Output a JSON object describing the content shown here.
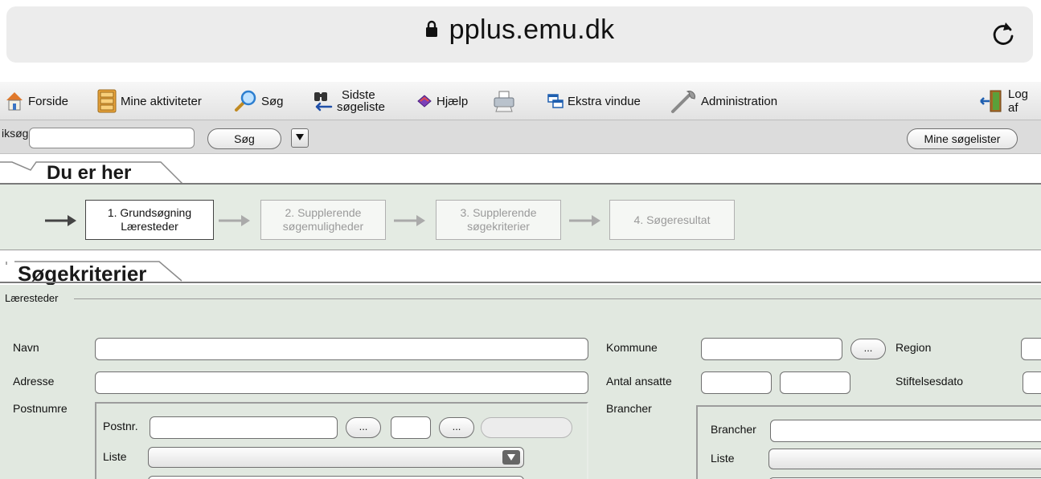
{
  "browser": {
    "url": "pplus.emu.dk",
    "icons": {
      "lock": "lock-icon",
      "reload": "reload-icon"
    }
  },
  "toolbar": {
    "forside": "Forside",
    "mine_aktiviteter": "Mine aktiviteter",
    "soeg": "Søg",
    "sidste_line1": "Sidste",
    "sidste_line2": "søgeliste",
    "hjaelp": "Hjælp",
    "ekstra_vindue": "Ekstra vindue",
    "administration": "Administration",
    "log_af": "Log af"
  },
  "quicksearch": {
    "label": "iksøg",
    "input_value": "",
    "button": "Søg",
    "mine_soegelister": "Mine søgelister"
  },
  "breadcrumb": {
    "title": "Du er her",
    "steps": [
      {
        "line1": "1. Grundsøgning",
        "line2": "Læresteder",
        "active": true
      },
      {
        "line1": "2. Supplerende",
        "line2": "søgemuligheder",
        "active": false
      },
      {
        "line1": "3. Supplerende",
        "line2": "søgekriterier",
        "active": false
      },
      {
        "line1": "4. Søgeresultat",
        "line2": "",
        "active": false
      }
    ]
  },
  "criteria": {
    "title": "Søgekriterier",
    "fieldset_legend": "Læresteder",
    "labels": {
      "navn": "Navn",
      "adresse": "Adresse",
      "postnumre": "Postnumre",
      "kommune": "Kommune",
      "region": "Region",
      "antal_ansatte": "Antal ansatte",
      "stiftelsesdato": "Stiftelsesdato",
      "brancher": "Brancher",
      "postnr": "Postnr.",
      "liste": "Liste",
      "brancher_inner": "Brancher",
      "liste_right": "Liste"
    },
    "values": {
      "navn": "",
      "adresse": "",
      "kommune": "",
      "antal_ansatte_fra": "",
      "antal_ansatte_til": "",
      "postnr_fra": "",
      "postnr_til": "",
      "brancher": ""
    },
    "ellipsis": "..."
  },
  "colors": {
    "panel_bg": "#e1e8e0",
    "toolbar_bg": "#e6e6e6",
    "active_step_border": "#444444",
    "inactive_step_text": "#9a9a9a"
  }
}
